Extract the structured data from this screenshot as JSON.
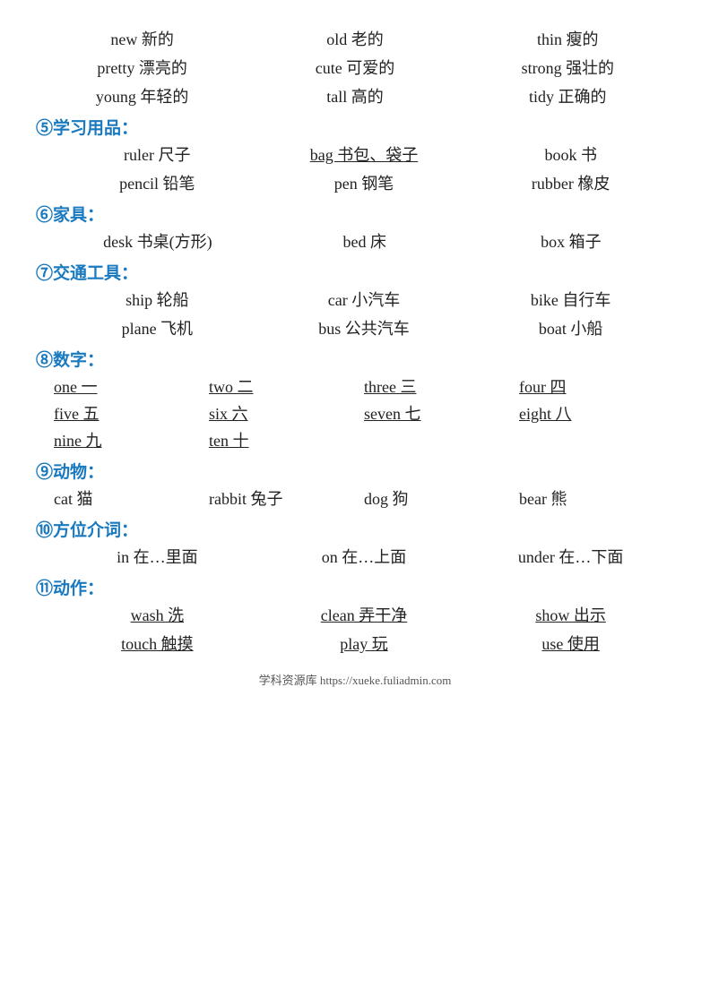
{
  "sections": {
    "adjectives_row1": [
      "new 新的",
      "old 老的",
      "thin 瘦的"
    ],
    "adjectives_row2": [
      "pretty 漂亮的",
      "cute 可爱的",
      "strong 强壮的"
    ],
    "adjectives_row3": [
      "young 年轻的",
      "tall 高的",
      "tidy 正确的"
    ],
    "section5_header": "⑤学习用品：",
    "school_row1": [
      "ruler 尺子",
      "bag 书包、袋子",
      "book 书"
    ],
    "school_row2": [
      "pencil 铅笔",
      "pen 钢笔",
      "rubber 橡皮"
    ],
    "section6_header": "⑥家具：",
    "furniture_row1": [
      "desk 书桌(方形)",
      "bed 床",
      "box 箱子"
    ],
    "section7_header": "⑦交通工具：",
    "transport_row1": [
      "ship 轮船",
      "car 小汽车",
      "bike 自行车"
    ],
    "transport_row2": [
      "plane 飞机",
      "bus 公共汽车",
      "boat 小船"
    ],
    "section8_header": "⑧数字：",
    "numbers_row1": [
      "one 一",
      "two 二",
      "three 三",
      "four 四"
    ],
    "numbers_row2": [
      "five 五",
      "six 六",
      "seven 七",
      "eight 八"
    ],
    "numbers_row3": [
      "nine 九",
      "ten 十"
    ],
    "section9_header": "⑨动物：",
    "animals_row1": [
      "cat 猫",
      "rabbit 兔子",
      "dog 狗",
      "bear 熊"
    ],
    "section10_header": "⑩方位介词：",
    "prepositions_row1": [
      "in 在…里面",
      "on 在…上面",
      "under 在…下面"
    ],
    "section11_header": "⑪动作：",
    "actions_row1": [
      "wash 洗",
      "clean 弄干净",
      "show 出示"
    ],
    "actions_row2": [
      "touch 触摸",
      "play 玩",
      "use 使用"
    ],
    "footer": "学科资源库 https://xueke.fuliadmin.com",
    "underlined_school": [
      0,
      1
    ],
    "underlined_school2": [],
    "underlined_furniture": [
      0
    ],
    "underlined_numbers_row1": [
      0,
      1,
      2,
      3
    ],
    "underlined_numbers_row2": [
      0,
      1,
      2,
      3
    ],
    "underlined_numbers_row3": [
      0,
      1
    ],
    "underlined_actions": [
      0,
      1,
      2
    ],
    "underlined_actions2": [
      0,
      1,
      2
    ]
  }
}
